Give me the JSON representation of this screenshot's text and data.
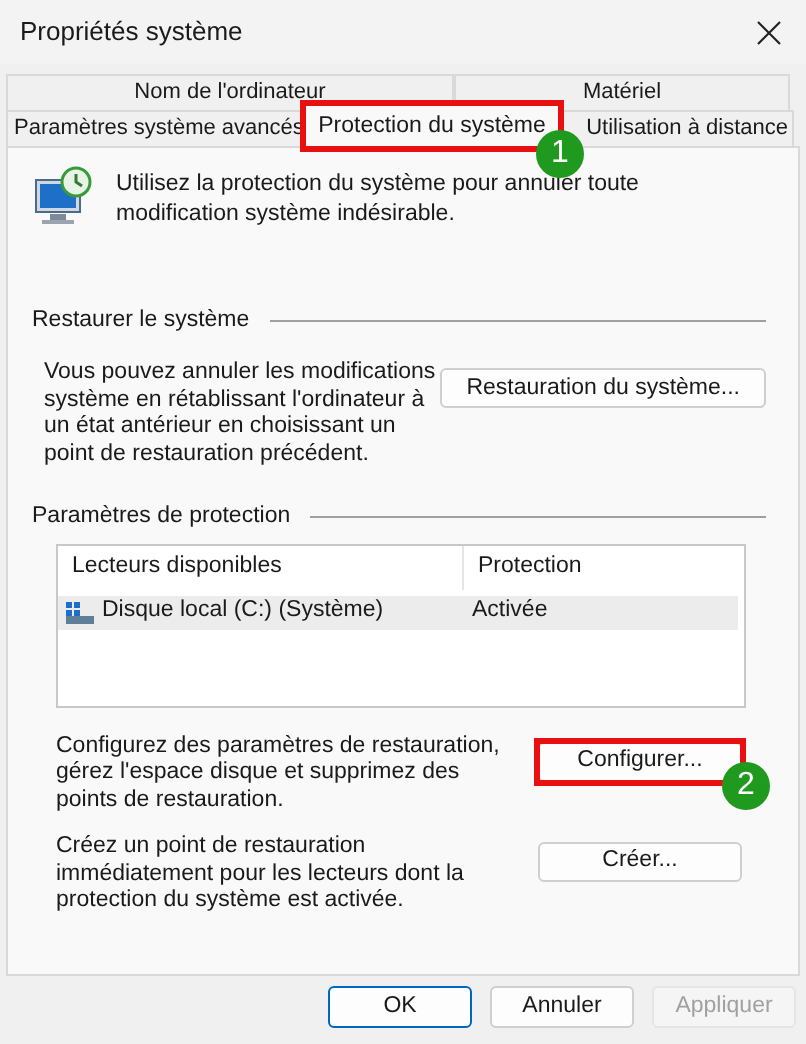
{
  "window": {
    "title": "Propriétés système"
  },
  "tab_rows": [
    {
      "tabs": [
        {
          "label": "Nom de l'ordinateur",
          "selected": false
        },
        {
          "label": "Matériel",
          "selected": false
        }
      ]
    },
    {
      "tabs": [
        {
          "label": "Paramètres système avancés",
          "selected": false
        },
        {
          "label": "Protection du système",
          "selected": true,
          "callout": "1"
        },
        {
          "label": "Utilisation à distance",
          "selected": false
        }
      ]
    }
  ],
  "intro": "Utilisez la protection du système pour annuler toute modification système indésirable.",
  "restore": {
    "title": "Restaurer le système",
    "text": "Vous pouvez annuler les modifications système en rétablissant l'ordinateur à un état antérieur en choisissant un point de restauration précédent.",
    "button": "Restauration du système..."
  },
  "protection": {
    "title": "Paramètres de protection",
    "table": {
      "columns": [
        "Lecteurs disponibles",
        "Protection"
      ],
      "rows": [
        {
          "drive": "Disque local (C:) (Système)",
          "protection": "Activée",
          "selected": true
        }
      ]
    },
    "actions": [
      {
        "text": "Configurez des paramètres de restauration, gérez l'espace disque et supprimez des points de restauration.",
        "button": "Configurer...",
        "callout": "2"
      },
      {
        "text": "Créez un point de restauration immédiatement pour les lecteurs dont la protection du système est activée.",
        "button": "Créer..."
      }
    ]
  },
  "footer_buttons": [
    {
      "label": "OK",
      "kind": "default",
      "disabled": false
    },
    {
      "label": "Annuler",
      "kind": "normal",
      "disabled": false
    },
    {
      "label": "Appliquer",
      "kind": "normal",
      "disabled": true
    }
  ]
}
